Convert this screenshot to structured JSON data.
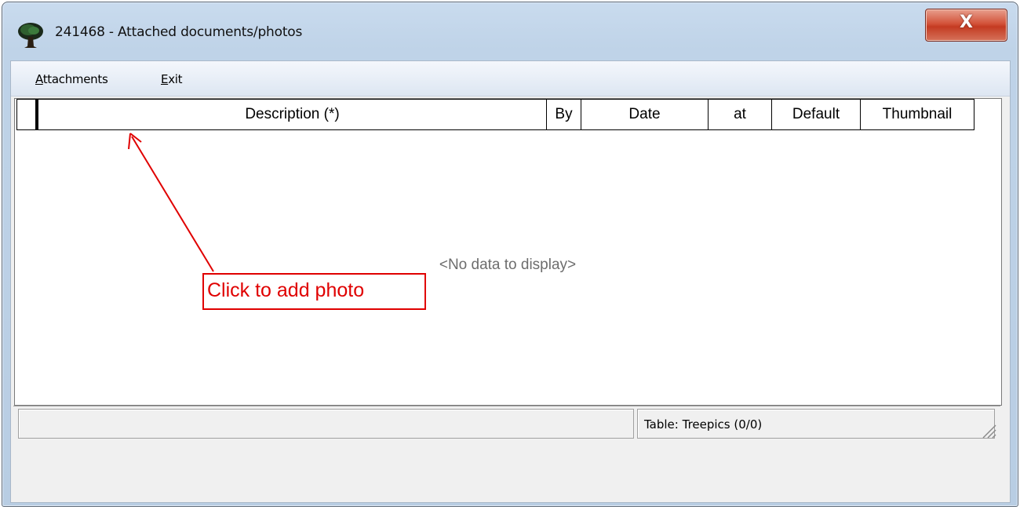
{
  "window": {
    "title": "241468 - Attached documents/photos",
    "close_label": "X"
  },
  "menu": {
    "items": [
      {
        "accel": "A",
        "rest": "ttachments"
      },
      {
        "accel": "E",
        "rest": "xit"
      }
    ]
  },
  "toolbar": {
    "buttons": [
      {
        "icon": "camera-icon",
        "enabled": false
      },
      {
        "icon": "frame-icon",
        "enabled": false
      },
      {
        "icon": "new-document-icon",
        "enabled": true
      },
      {
        "icon": "delete-icon",
        "enabled": false
      },
      {
        "icon": "edit-icon",
        "enabled": false
      }
    ],
    "view_buttons": [
      {
        "icon": "grid-view-icon"
      },
      {
        "icon": "copy-pages-icon"
      }
    ]
  },
  "grid": {
    "columns": [
      "Description (*)",
      "By",
      "Date",
      "at",
      "Default",
      "Thumbnail"
    ],
    "rows": [],
    "empty_text": "<No data to display>"
  },
  "status": {
    "table_text": "Table: Treepics (0/0)"
  },
  "annotation": {
    "text": "Click to add photo",
    "color": "#e00000"
  }
}
